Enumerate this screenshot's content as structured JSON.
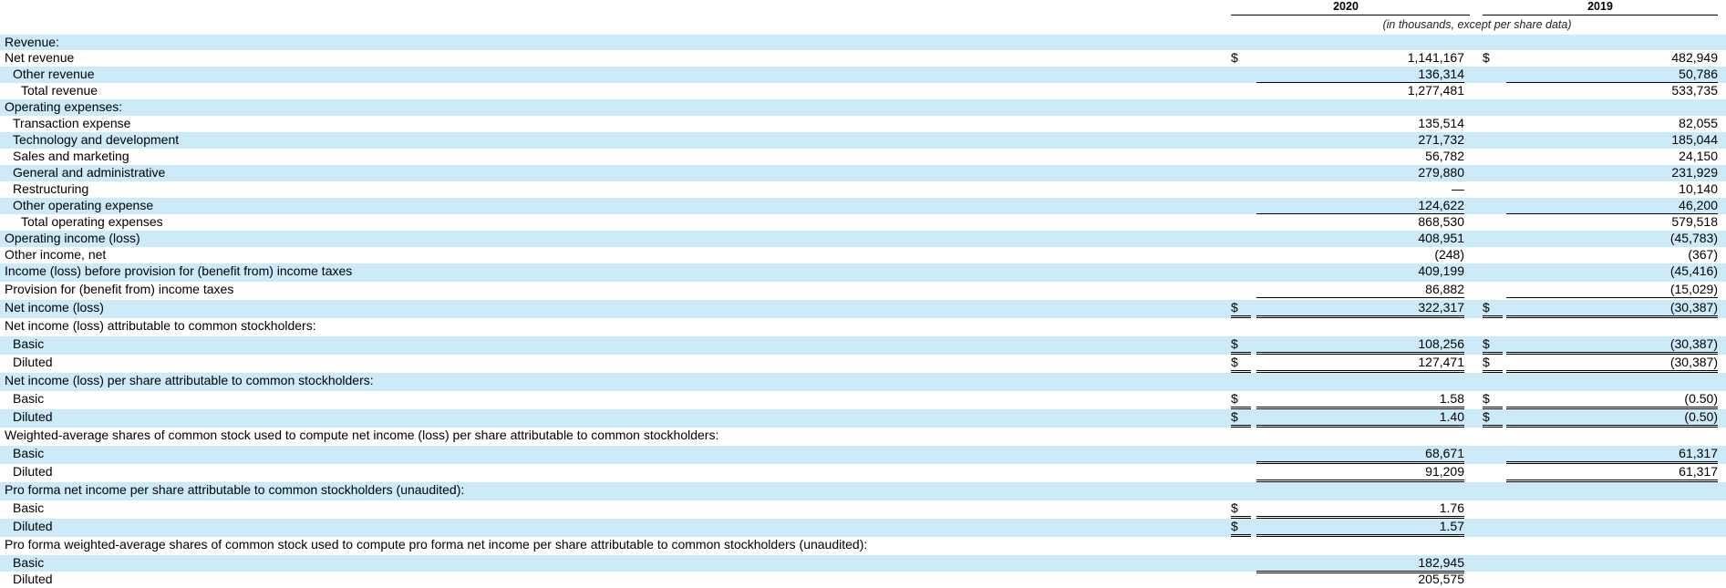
{
  "header": {
    "year_2020": "2020",
    "year_2019": "2019",
    "units_note": "(in thousands, except per share data)"
  },
  "rows": [
    {
      "label": "Revenue:",
      "indent": 0,
      "shade": true
    },
    {
      "label": "Net revenue",
      "indent": 0,
      "shade": false,
      "d1": "$",
      "v2020": "1,141,167",
      "d2": "$",
      "v2019": "482,949"
    },
    {
      "label": "Other revenue",
      "indent": 1,
      "shade": true,
      "v2020": "136,314",
      "v2019": "50,786"
    },
    {
      "label": "Total revenue",
      "indent": 2,
      "shade": false,
      "v2020": "1,277,481",
      "v2019": "533,735"
    },
    {
      "label": "Operating expenses:",
      "indent": 0,
      "shade": true
    },
    {
      "label": "Transaction expense",
      "indent": 1,
      "shade": false,
      "v2020": "135,514",
      "v2019": "82,055"
    },
    {
      "label": "Technology and development",
      "indent": 1,
      "shade": true,
      "v2020": "271,732",
      "v2019": "185,044"
    },
    {
      "label": "Sales and marketing",
      "indent": 1,
      "shade": false,
      "v2020": "56,782",
      "v2019": "24,150"
    },
    {
      "label": "General and administrative",
      "indent": 1,
      "shade": true,
      "v2020": "279,880",
      "v2019": "231,929"
    },
    {
      "label": "Restructuring",
      "indent": 1,
      "shade": false,
      "v2020": "—",
      "v2019": "10,140"
    },
    {
      "label": "Other operating expense",
      "indent": 1,
      "shade": true,
      "v2020": "124,622",
      "v2019": "46,200"
    },
    {
      "label": "Total operating expenses",
      "indent": 2,
      "shade": false,
      "v2020": "868,530",
      "v2019": "579,518"
    },
    {
      "label": "Operating income (loss)",
      "indent": 0,
      "shade": true,
      "v2020": "408,951",
      "v2019": "(45,783)"
    },
    {
      "label": "Other income, net",
      "indent": 0,
      "shade": false,
      "v2020": "(248)",
      "v2019": "(367)"
    },
    {
      "label": "Income (loss) before provision for (benefit from) income taxes",
      "indent": 0,
      "shade": true,
      "v2020": "409,199",
      "v2019": "(45,416)"
    },
    {
      "label": "Provision for (benefit from) income taxes",
      "indent": 0,
      "shade": false,
      "v2020": "86,882",
      "v2019": "(15,029)"
    },
    {
      "label": "Net income (loss)",
      "indent": 0,
      "shade": true,
      "d1": "$",
      "v2020": "322,317",
      "d2": "$",
      "v2019": "(30,387)"
    },
    {
      "label": "Net income (loss) attributable to common stockholders:",
      "indent": 0,
      "shade": false
    },
    {
      "label": "Basic",
      "indent": 1,
      "shade": true,
      "d1": "$",
      "v2020": "108,256",
      "d2": "$",
      "v2019": "(30,387)"
    },
    {
      "label": "Diluted",
      "indent": 1,
      "shade": false,
      "d1": "$",
      "v2020": "127,471",
      "d2": "$",
      "v2019": "(30,387)"
    },
    {
      "label": "Net income (loss) per share attributable to common stockholders:",
      "indent": 0,
      "shade": true
    },
    {
      "label": "Basic",
      "indent": 1,
      "shade": false,
      "d1": "$",
      "v2020": "1.58",
      "d2": "$",
      "v2019": "(0.50)"
    },
    {
      "label": "Diluted",
      "indent": 1,
      "shade": true,
      "d1": "$",
      "v2020": "1.40",
      "d2": "$",
      "v2019": "(0.50)"
    },
    {
      "label": "Weighted-average shares of common stock used to compute net income (loss) per share attributable to common stockholders:",
      "indent": 0,
      "shade": false
    },
    {
      "label": "Basic",
      "indent": 1,
      "shade": true,
      "v2020": "68,671",
      "v2019": "61,317"
    },
    {
      "label": "Diluted",
      "indent": 1,
      "shade": false,
      "v2020": "91,209",
      "v2019": "61,317"
    },
    {
      "label": "Pro forma net income per share attributable to common stockholders (unaudited):",
      "indent": 0,
      "shade": true
    },
    {
      "label": "Basic",
      "indent": 1,
      "shade": false,
      "d1": "$",
      "v2020": "1.76"
    },
    {
      "label": "Diluted",
      "indent": 1,
      "shade": true,
      "d1": "$",
      "v2020": "1.57"
    },
    {
      "label": "Pro forma weighted-average shares of common stock used to compute pro forma net income per share attributable to common stockholders (unaudited):",
      "indent": 0,
      "shade": false
    },
    {
      "label": "Basic",
      "indent": 1,
      "shade": true,
      "v2020": "182,945"
    },
    {
      "label": "Diluted",
      "indent": 1,
      "shade": false,
      "v2020": "205,575"
    }
  ]
}
